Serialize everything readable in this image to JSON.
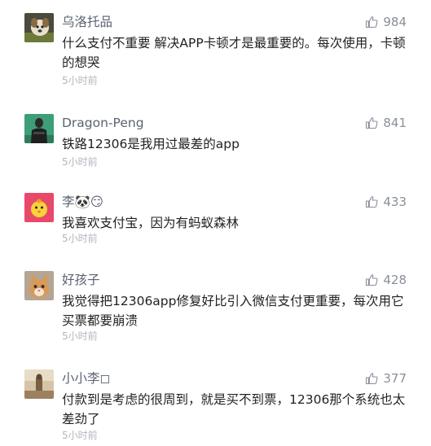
{
  "comments": [
    {
      "username": "乌洛托品",
      "likes": "984",
      "content": "什么支付不重要 解决APP卡顿才是最重要的。每次使用，卡顿的想哭",
      "time": "5小时前",
      "avatar_icon": "dog-avatar-icon"
    },
    {
      "username": "Dragon-Peng",
      "likes": "841",
      "content": "铁路12306是我用过最差的app",
      "time": "5小时前",
      "avatar_icon": "person-avatar-icon"
    },
    {
      "username": "李🐼😏",
      "likes": "433",
      "content": "我喜欢支付宝，因为有蚂蚁森林",
      "time": "5小时前",
      "avatar_icon": "chick-avatar-icon"
    },
    {
      "username": "好孩子",
      "likes": "428",
      "content": "我觉得把12306app修复好比引入微信支付更重要，每次用它买票都要崩溃",
      "time": "5小时前",
      "avatar_icon": "cat-avatar-icon"
    },
    {
      "username": "小小李◻",
      "likes": "377",
      "content": "付款到是考虑的很周到，就是买不到票，12306那个系统也太差劲了",
      "time": "5小时前",
      "avatar_icon": "photo-avatar-icon"
    }
  ],
  "colors": {
    "username": "#5b6371",
    "content": "#222222",
    "time": "#b2b6bd",
    "like_icon": "#8a8f99"
  }
}
